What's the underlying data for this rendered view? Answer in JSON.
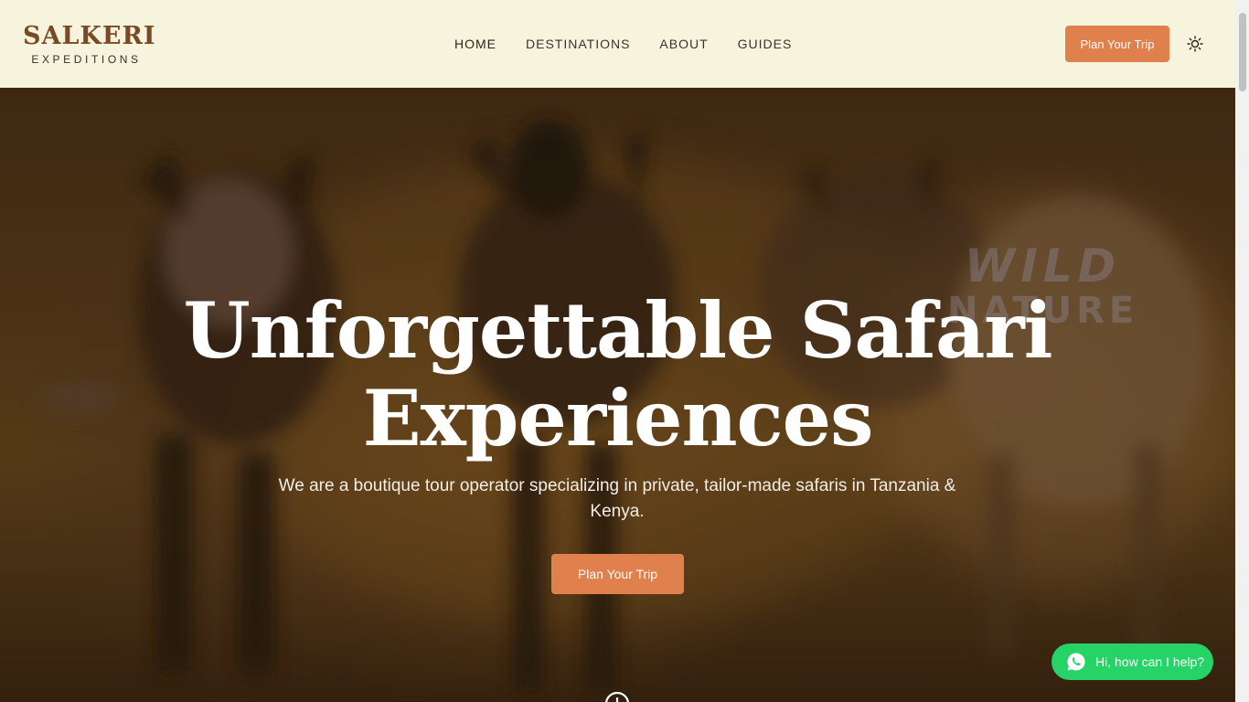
{
  "brand": {
    "name": "SALKERI",
    "tagline": "EXPEDITIONS"
  },
  "nav": {
    "items": [
      {
        "label": "HOME"
      },
      {
        "label": "DESTINATIONS"
      },
      {
        "label": "ABOUT"
      },
      {
        "label": "GUIDES"
      }
    ]
  },
  "header": {
    "cta_label": "Plan Your Trip",
    "theme_icon": "sun-icon"
  },
  "hero": {
    "title_line1": "Unforgettable Safari",
    "title_line2": "Experiences",
    "subtitle": "We are a boutique tour operator specializing in private, tailor-made safaris in Tanzania & Kenya.",
    "cta_label": "Plan Your Trip",
    "watermark_line1": "WILD",
    "watermark_line2": "NATURE",
    "scroll_icon": "scroll-down-icon"
  },
  "chat": {
    "label": "Hi, how can I help?",
    "icon": "whatsapp-icon"
  },
  "colors": {
    "header_bg": "#f6f4dc",
    "brand": "#7a4a26",
    "accent": "#e0804c",
    "whatsapp": "#25d366"
  }
}
